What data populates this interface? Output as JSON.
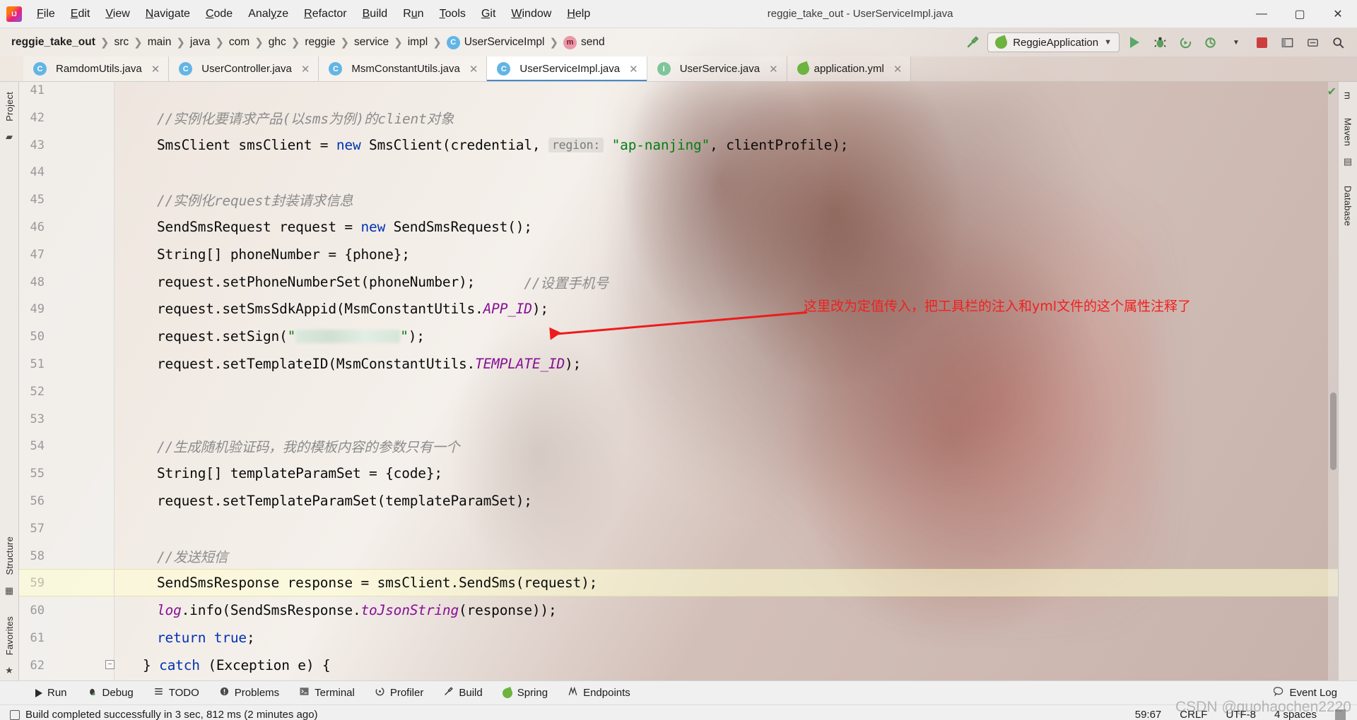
{
  "window": {
    "title": "reggie_take_out - UserServiceImpl.java",
    "app_icon": "intellij-idea-logo",
    "minimize": "—",
    "maximize": "▢",
    "close": "✕"
  },
  "menubar": {
    "items": [
      {
        "label": "File",
        "mnemonic": "F"
      },
      {
        "label": "Edit",
        "mnemonic": "E"
      },
      {
        "label": "View",
        "mnemonic": "V"
      },
      {
        "label": "Navigate",
        "mnemonic": "N"
      },
      {
        "label": "Code",
        "mnemonic": "C"
      },
      {
        "label": "Analyze",
        "mnemonic": "y"
      },
      {
        "label": "Refactor",
        "mnemonic": "R"
      },
      {
        "label": "Build",
        "mnemonic": "B"
      },
      {
        "label": "Run",
        "mnemonic": "u"
      },
      {
        "label": "Tools",
        "mnemonic": "T"
      },
      {
        "label": "Git",
        "mnemonic": "G"
      },
      {
        "label": "Window",
        "mnemonic": "W"
      },
      {
        "label": "Help",
        "mnemonic": "H"
      }
    ]
  },
  "breadcrumb": {
    "items": [
      {
        "label": "reggie_take_out",
        "type": "project"
      },
      {
        "label": "src",
        "type": "folder"
      },
      {
        "label": "main",
        "type": "folder"
      },
      {
        "label": "java",
        "type": "folder"
      },
      {
        "label": "com",
        "type": "folder"
      },
      {
        "label": "ghc",
        "type": "folder"
      },
      {
        "label": "reggie",
        "type": "folder"
      },
      {
        "label": "service",
        "type": "folder"
      },
      {
        "label": "impl",
        "type": "folder"
      },
      {
        "label": "UserServiceImpl",
        "type": "class",
        "badge": "C"
      },
      {
        "label": "send",
        "type": "method",
        "badge": "m"
      }
    ]
  },
  "toolbar": {
    "build_hammer_icon": "hammer-icon",
    "run_config": "ReggieApplication",
    "run_config_icon": "spring-leaf-icon",
    "dropdown_caret": "▼",
    "run_icon": "run-play-icon",
    "debug_icon": "debug-bug-icon",
    "coverage_icon": "run-coverage-icon",
    "profile_icon": "run-profile-icon",
    "stop_icon": "stop-square-icon",
    "layout_icon": "layout-icon",
    "updates_icon": "updates-icon",
    "search_icon": "search-everywhere-icon"
  },
  "tabs": [
    {
      "label": "RamdomUtils.java",
      "badge": "C",
      "badge_kind": "class",
      "active": false,
      "close": "✕"
    },
    {
      "label": "UserController.java",
      "badge": "C",
      "badge_kind": "class",
      "active": false,
      "close": "✕"
    },
    {
      "label": "MsmConstantUtils.java",
      "badge": "C",
      "badge_kind": "class",
      "active": false,
      "close": "✕"
    },
    {
      "label": "UserServiceImpl.java",
      "badge": "C",
      "badge_kind": "class",
      "active": true,
      "close": "✕"
    },
    {
      "label": "UserService.java",
      "badge": "I",
      "badge_kind": "interface",
      "active": false,
      "close": "✕"
    },
    {
      "label": "application.yml",
      "badge": "yml",
      "badge_kind": "spring",
      "active": false,
      "close": "✕"
    }
  ],
  "left_rail": {
    "project_label": "Project",
    "structure_label": "Structure",
    "favorites_label": "Favorites"
  },
  "right_rail": {
    "maven_label": "Maven",
    "database_label": "Database",
    "m_label": "m"
  },
  "editor": {
    "first_line": 41,
    "highlight_line": 59,
    "inspection_status": "✔",
    "lines": [
      {
        "n": 41,
        "tokens": []
      },
      {
        "n": 42,
        "tokens": [
          {
            "t": "//实例化要请求产品(以sms为例)的client对象",
            "c": "cmt"
          }
        ],
        "indent": 2
      },
      {
        "n": 43,
        "tokens": [
          {
            "t": "SmsClient smsClient = ",
            "c": ""
          },
          {
            "t": "new",
            "c": "kw"
          },
          {
            "t": " SmsClient(credential, ",
            "c": ""
          },
          {
            "t": "region:",
            "c": "hint"
          },
          {
            "t": " ",
            "c": ""
          },
          {
            "t": "\"ap-nanjing\"",
            "c": "str"
          },
          {
            "t": ", clientProfile);",
            "c": ""
          }
        ],
        "indent": 2
      },
      {
        "n": 44,
        "tokens": []
      },
      {
        "n": 45,
        "tokens": [
          {
            "t": "//实例化request封装请求信息",
            "c": "cmt"
          }
        ],
        "indent": 2
      },
      {
        "n": 46,
        "tokens": [
          {
            "t": "SendSmsRequest request = ",
            "c": ""
          },
          {
            "t": "new",
            "c": "kw"
          },
          {
            "t": " SendSmsRequest();",
            "c": ""
          }
        ],
        "indent": 2
      },
      {
        "n": 47,
        "tokens": [
          {
            "t": "String[] phoneNumber = {phone};",
            "c": ""
          }
        ],
        "indent": 2
      },
      {
        "n": 48,
        "tokens": [
          {
            "t": "request.setPhoneNumberSet(phoneNumber);",
            "c": ""
          },
          {
            "t": "      ",
            "c": ""
          },
          {
            "t": "//设置手机号",
            "c": "cmt"
          }
        ],
        "indent": 2
      },
      {
        "n": 49,
        "tokens": [
          {
            "t": "request.setSmsSdkAppid(MsmConstantUtils.",
            "c": ""
          },
          {
            "t": "APP_ID",
            "c": "cst"
          },
          {
            "t": ");",
            "c": ""
          }
        ],
        "indent": 2
      },
      {
        "n": 50,
        "tokens": [
          {
            "t": "request.setSign(",
            "c": ""
          },
          {
            "t": "\"",
            "c": "str"
          },
          {
            "t": "REDACTED",
            "c": "redact"
          },
          {
            "t": "\"",
            "c": "str"
          },
          {
            "t": ");",
            "c": ""
          }
        ],
        "indent": 2
      },
      {
        "n": 51,
        "tokens": [
          {
            "t": "request.setTemplateID(MsmConstantUtils.",
            "c": ""
          },
          {
            "t": "TEMPLATE_ID",
            "c": "cst"
          },
          {
            "t": ");",
            "c": ""
          }
        ],
        "indent": 2
      },
      {
        "n": 52,
        "tokens": []
      },
      {
        "n": 53,
        "tokens": []
      },
      {
        "n": 54,
        "tokens": [
          {
            "t": "//生成随机验证码，我的模板内容的参数只有一个",
            "c": "cmt"
          }
        ],
        "indent": 2
      },
      {
        "n": 55,
        "tokens": [
          {
            "t": "String[] templateParamSet = {code};",
            "c": ""
          }
        ],
        "indent": 2
      },
      {
        "n": 56,
        "tokens": [
          {
            "t": "request.setTemplateParamSet(templateParamSet);",
            "c": ""
          }
        ],
        "indent": 2
      },
      {
        "n": 57,
        "tokens": []
      },
      {
        "n": 58,
        "tokens": [
          {
            "t": "//发送短信",
            "c": "cmt"
          }
        ],
        "indent": 2
      },
      {
        "n": 59,
        "tokens": [
          {
            "t": "SendSmsResponse response = smsClient.SendSms(request);",
            "c": ""
          }
        ],
        "indent": 2
      },
      {
        "n": 60,
        "tokens": [
          {
            "t": "log",
            "c": "fld"
          },
          {
            "t": ".info(SendSmsResponse.",
            "c": ""
          },
          {
            "t": "toJsonString",
            "c": "cst"
          },
          {
            "t": "(response));",
            "c": ""
          }
        ],
        "indent": 2
      },
      {
        "n": 61,
        "tokens": [
          {
            "t": "return",
            "c": "kw"
          },
          {
            "t": " ",
            "c": ""
          },
          {
            "t": "true",
            "c": "kw"
          },
          {
            "t": ";",
            "c": ""
          }
        ],
        "indent": 2
      },
      {
        "n": 62,
        "tokens": [
          {
            "t": "} ",
            "c": ""
          },
          {
            "t": "catch",
            "c": "kw"
          },
          {
            "t": " (Exception e) {",
            "c": ""
          }
        ],
        "indent": 1
      }
    ]
  },
  "annotation": {
    "text": "这里改为定值传入，把工具栏的注入和yml文件的这个属性注释了",
    "color": "#f02020",
    "arrow": "arrow-pointing-left-to-setSign-string"
  },
  "bottom_bar": {
    "items": [
      {
        "label": "Run",
        "icon": "run-play-icon"
      },
      {
        "label": "Debug",
        "icon": "debug-bug-icon"
      },
      {
        "label": "TODO",
        "icon": "todo-list-icon"
      },
      {
        "label": "Problems",
        "icon": "problems-warning-icon"
      },
      {
        "label": "Terminal",
        "icon": "terminal-icon"
      },
      {
        "label": "Profiler",
        "icon": "profiler-icon"
      },
      {
        "label": "Build",
        "icon": "build-hammer-icon"
      },
      {
        "label": "Spring",
        "icon": "spring-leaf-icon"
      },
      {
        "label": "Endpoints",
        "icon": "endpoints-icon"
      }
    ],
    "event_log": "Event Log",
    "event_log_icon": "event-log-icon"
  },
  "statusbar": {
    "message": "Build completed successfully in 3 sec, 812 ms (2 minutes ago)",
    "message_icon": "build-status-icon",
    "caret_position": "59:67",
    "line_separator": "CRLF",
    "encoding": "UTF-8",
    "indent": "4 spaces",
    "hdd_icon": "memory-indicator-icon"
  },
  "watermark": "CSDN @guohaochen2220"
}
